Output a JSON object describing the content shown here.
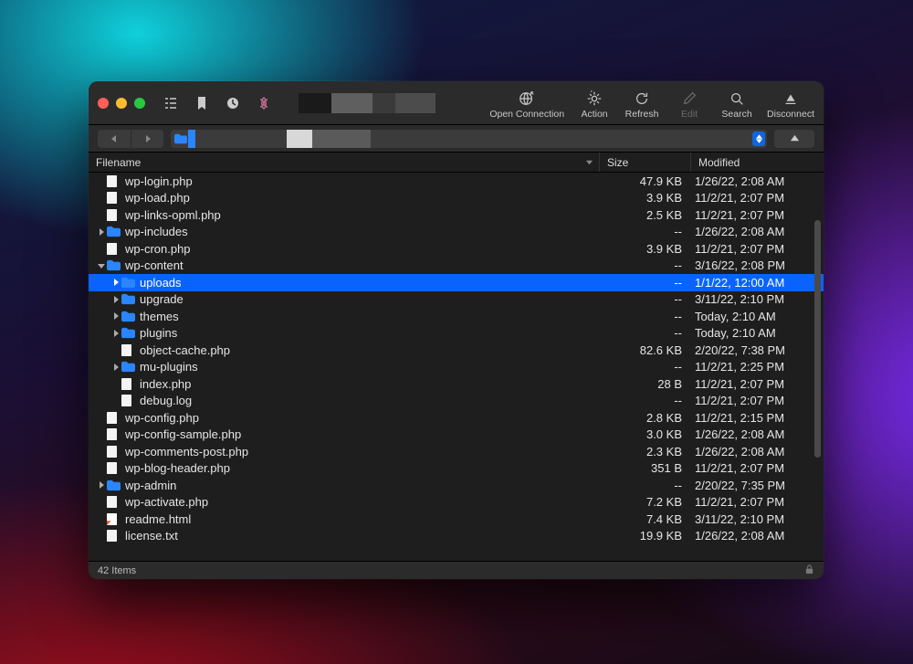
{
  "toolbar": {
    "open_connection": "Open Connection",
    "action": "Action",
    "refresh": "Refresh",
    "edit": "Edit",
    "search": "Search",
    "disconnect": "Disconnect"
  },
  "columns": {
    "filename": "Filename",
    "size": "Size",
    "modified": "Modified"
  },
  "status": {
    "items": "42 Items"
  },
  "files": [
    {
      "depth": 1,
      "type": "file",
      "name": "wp-login.php",
      "size": "47.9 KB",
      "modified": "1/26/22, 2:08 AM"
    },
    {
      "depth": 1,
      "type": "file",
      "name": "wp-load.php",
      "size": "3.9 KB",
      "modified": "11/2/21, 2:07 PM"
    },
    {
      "depth": 1,
      "type": "file",
      "name": "wp-links-opml.php",
      "size": "2.5 KB",
      "modified": "11/2/21, 2:07 PM"
    },
    {
      "depth": 1,
      "type": "folder",
      "name": "wp-includes",
      "size": "--",
      "modified": "1/26/22, 2:08 AM",
      "disclosure": "closed"
    },
    {
      "depth": 1,
      "type": "file",
      "name": "wp-cron.php",
      "size": "3.9 KB",
      "modified": "11/2/21, 2:07 PM"
    },
    {
      "depth": 1,
      "type": "folder",
      "name": "wp-content",
      "size": "--",
      "modified": "3/16/22, 2:08 PM",
      "disclosure": "open"
    },
    {
      "depth": 2,
      "type": "folder",
      "name": "uploads",
      "size": "--",
      "modified": "1/1/22, 12:00 AM",
      "disclosure": "closed",
      "selected": true
    },
    {
      "depth": 2,
      "type": "folder",
      "name": "upgrade",
      "size": "--",
      "modified": "3/11/22, 2:10 PM",
      "disclosure": "closed"
    },
    {
      "depth": 2,
      "type": "folder",
      "name": "themes",
      "size": "--",
      "modified": "Today, 2:10 AM",
      "disclosure": "closed"
    },
    {
      "depth": 2,
      "type": "folder",
      "name": "plugins",
      "size": "--",
      "modified": "Today, 2:10 AM",
      "disclosure": "closed"
    },
    {
      "depth": 2,
      "type": "file",
      "name": "object-cache.php",
      "size": "82.6 KB",
      "modified": "2/20/22, 7:38 PM"
    },
    {
      "depth": 2,
      "type": "folder",
      "name": "mu-plugins",
      "size": "--",
      "modified": "11/2/21, 2:25 PM",
      "disclosure": "closed"
    },
    {
      "depth": 2,
      "type": "file",
      "name": "index.php",
      "size": "28 B",
      "modified": "11/2/21, 2:07 PM"
    },
    {
      "depth": 2,
      "type": "log",
      "name": "debug.log",
      "size": "--",
      "modified": "11/2/21, 2:07 PM"
    },
    {
      "depth": 1,
      "type": "file",
      "name": "wp-config.php",
      "size": "2.8 KB",
      "modified": "11/2/21, 2:15 PM"
    },
    {
      "depth": 1,
      "type": "file",
      "name": "wp-config-sample.php",
      "size": "3.0 KB",
      "modified": "1/26/22, 2:08 AM"
    },
    {
      "depth": 1,
      "type": "file",
      "name": "wp-comments-post.php",
      "size": "2.3 KB",
      "modified": "1/26/22, 2:08 AM"
    },
    {
      "depth": 1,
      "type": "file",
      "name": "wp-blog-header.php",
      "size": "351 B",
      "modified": "11/2/21, 2:07 PM"
    },
    {
      "depth": 1,
      "type": "folder",
      "name": "wp-admin",
      "size": "--",
      "modified": "2/20/22, 7:35 PM",
      "disclosure": "closed"
    },
    {
      "depth": 1,
      "type": "file",
      "name": "wp-activate.php",
      "size": "7.2 KB",
      "modified": "11/2/21, 2:07 PM"
    },
    {
      "depth": 1,
      "type": "html",
      "name": "readme.html",
      "size": "7.4 KB",
      "modified": "3/11/22, 2:10 PM"
    },
    {
      "depth": 1,
      "type": "file",
      "name": "license.txt",
      "size": "19.9 KB",
      "modified": "1/26/22, 2:08 AM"
    }
  ]
}
